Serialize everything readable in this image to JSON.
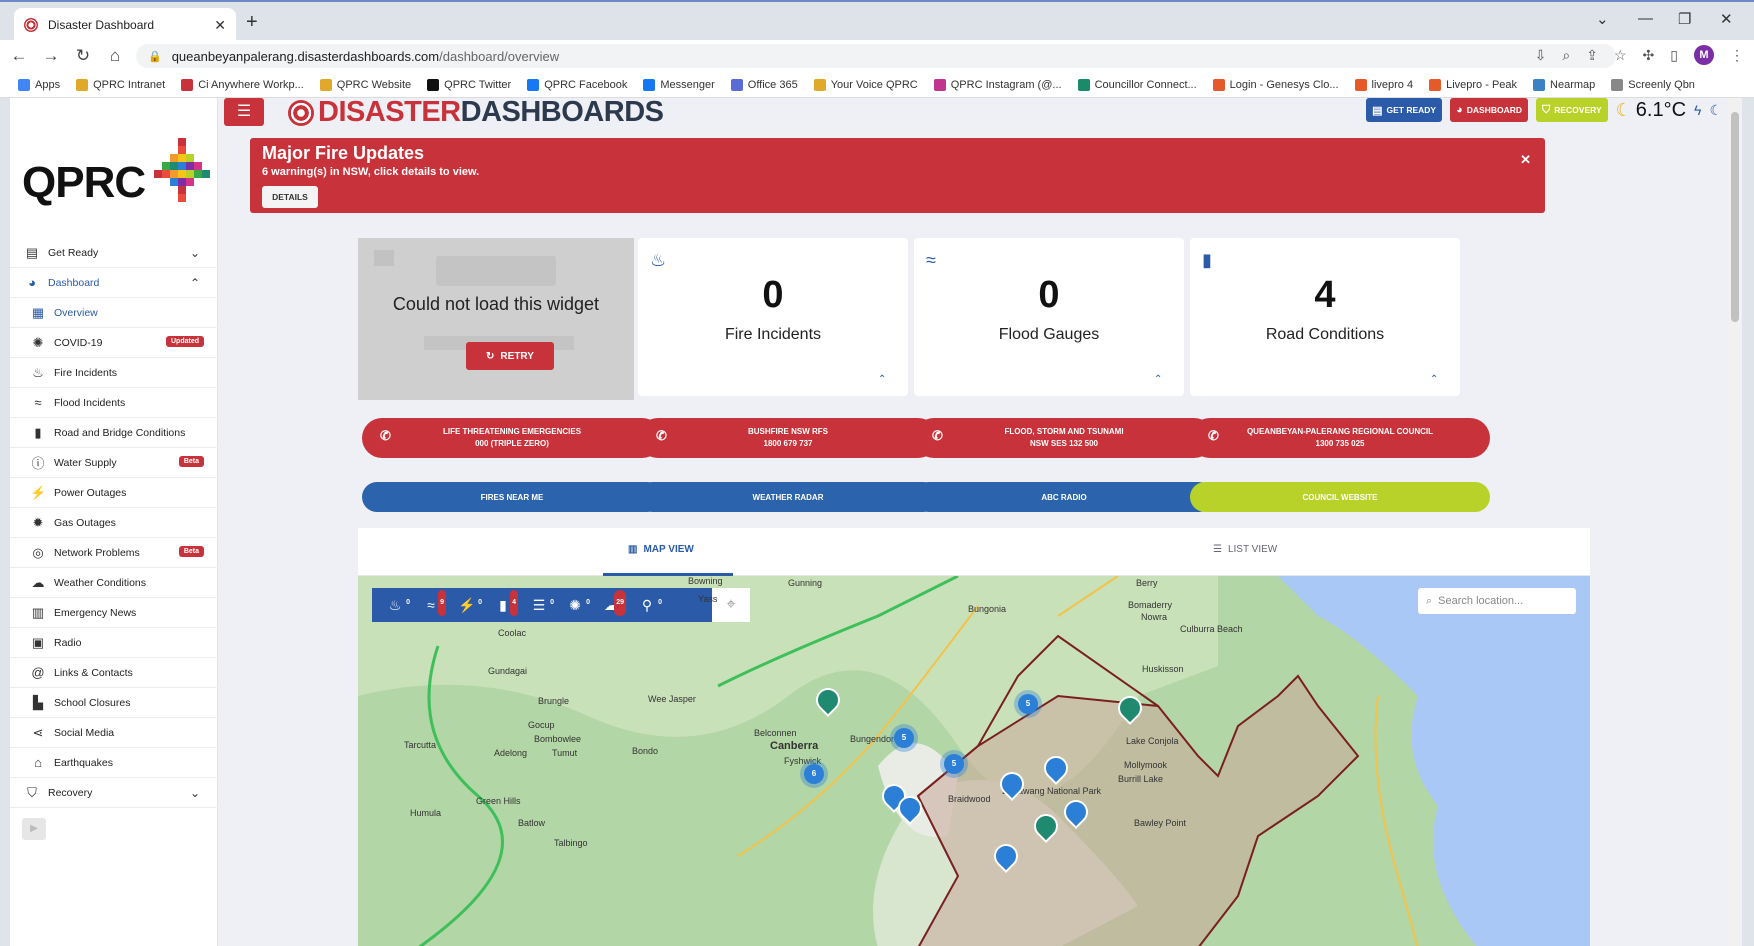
{
  "browser": {
    "tab_title": "Disaster Dashboard",
    "url_host": "queanbeyanpalerang.disasterdashboards.com",
    "url_path": "/dashboard/overview",
    "profile_initial": "M",
    "bookmarks": [
      "Apps",
      "QPRC Intranet",
      "Ci Anywhere Workp...",
      "QPRC Website",
      "QPRC Twitter",
      "QPRC Facebook",
      "Messenger",
      "Office 365",
      "Your Voice QPRC",
      "QPRC Instagram (@...",
      "Councillor Connect...",
      "Login - Genesys Clo...",
      "livepro 4",
      "Livepro - Peak",
      "Nearmap",
      "Screenly Qbn"
    ],
    "bookmark_colors": [
      "#4285f4",
      "#e0a92a",
      "#c8323a",
      "#e0a92a",
      "#111111",
      "#1877f2",
      "#1877f2",
      "#5b6bd6",
      "#e0a92a",
      "#c1358f",
      "#1a8a6a",
      "#e45a2a",
      "#e45a2a",
      "#e45a2a",
      "#3b82c4",
      "#888888"
    ]
  },
  "sidebar": {
    "logo_text": "QPRC",
    "items": [
      {
        "label": "Get Ready",
        "icon": "clipboard-icon",
        "glyph": "▤"
      },
      {
        "label": "Dashboard",
        "icon": "gauge-icon",
        "glyph": "◕"
      },
      {
        "label": "Overview",
        "icon": "grid-icon",
        "glyph": "▦"
      },
      {
        "label": "COVID-19",
        "icon": "virus-icon",
        "glyph": "✺",
        "badge": "Updated"
      },
      {
        "label": "Fire Incidents",
        "icon": "fire-icon",
        "glyph": "♨"
      },
      {
        "label": "Flood Incidents",
        "icon": "water-icon",
        "glyph": "≈"
      },
      {
        "label": "Road and Bridge Conditions",
        "icon": "road-icon",
        "glyph": "▮"
      },
      {
        "label": "Water Supply",
        "icon": "info-icon",
        "glyph": "ⓘ",
        "badge": "Beta"
      },
      {
        "label": "Power Outages",
        "icon": "power-tower-icon",
        "glyph": "⚡"
      },
      {
        "label": "Gas Outages",
        "icon": "gas-icon",
        "glyph": "✹"
      },
      {
        "label": "Network Problems",
        "icon": "network-icon",
        "glyph": "◎",
        "badge": "Beta"
      },
      {
        "label": "Weather Conditions",
        "icon": "weather-icon",
        "glyph": "☁"
      },
      {
        "label": "Emergency News",
        "icon": "news-icon",
        "glyph": "▥"
      },
      {
        "label": "Radio",
        "icon": "radio-icon",
        "glyph": "▣"
      },
      {
        "label": "Links & Contacts",
        "icon": "at-icon",
        "glyph": "@"
      },
      {
        "label": "School Closures",
        "icon": "school-icon",
        "glyph": "▙"
      },
      {
        "label": "Social Media",
        "icon": "share-icon",
        "glyph": "⋖"
      },
      {
        "label": "Earthquakes",
        "icon": "earthquake-icon",
        "glyph": "⌂"
      },
      {
        "label": "Recovery",
        "icon": "shield-icon",
        "glyph": "⛉"
      }
    ]
  },
  "header": {
    "brand_part1": "DISASTER",
    "brand_part2": "DASHBOARDS",
    "btn_get_ready": "GET READY",
    "btn_dashboard": "DASHBOARD",
    "btn_recovery": "RECOVERY",
    "temperature": "6.1°C"
  },
  "alert": {
    "title": "Major Fire Updates",
    "subtitle": "6 warning(s) in NSW, click details to view.",
    "details_label": "DETAILS",
    "close_glyph": "✕"
  },
  "widgets": {
    "error_message": "Could not load this widget",
    "retry_label": "RETRY",
    "cards": [
      {
        "value": "0",
        "label": "Fire Incidents"
      },
      {
        "value": "0",
        "label": "Flood Gauges"
      },
      {
        "value": "4",
        "label": "Road Conditions"
      }
    ]
  },
  "contacts": [
    {
      "line1": "LIFE THREATENING EMERGENCIES",
      "line2": "000 (TRIPLE ZERO)"
    },
    {
      "line1": "BUSHFIRE NSW RFS",
      "line2": "1800 679 737"
    },
    {
      "line1": "FLOOD, STORM AND TSUNAMI",
      "line2": "NSW SES 132 500"
    },
    {
      "line1": "QUEANBEYAN-PALERANG REGIONAL COUNCIL",
      "line2": "1300 735 025"
    }
  ],
  "links": [
    "FIRES NEAR ME",
    "WEATHER RADAR",
    "ABC RADIO",
    "COUNCIL WEBSITE"
  ],
  "map": {
    "tab_map": "MAP VIEW",
    "tab_list": "LIST VIEW",
    "search_placeholder": "Search location...",
    "layer_counts": [
      "0",
      "9",
      "0",
      "4",
      "0",
      "0",
      "29",
      "0"
    ],
    "places": [
      "Bowning",
      "Gunning",
      "Yass",
      "Bungonia",
      "Berry",
      "Bomaderry",
      "Nowra",
      "Culburra Beach",
      "Coolac",
      "Huskisson",
      "Gundagai",
      "Brungle",
      "Wee Jasper",
      "Gocup",
      "Bombowlee",
      "Tarcutta",
      "Adelong",
      "Tumut",
      "Belconnen",
      "Canberra",
      "Fyshwick",
      "Bungendore",
      "Bondo",
      "Braidwood",
      "Budawang National Park",
      "Lake Conjola",
      "Mollymook",
      "Burrill Lake",
      "Green Hills",
      "Humula",
      "Batlow",
      "Bawley Point",
      "Talbingo"
    ],
    "clusters": [
      "5",
      "5",
      "5",
      "6"
    ]
  }
}
